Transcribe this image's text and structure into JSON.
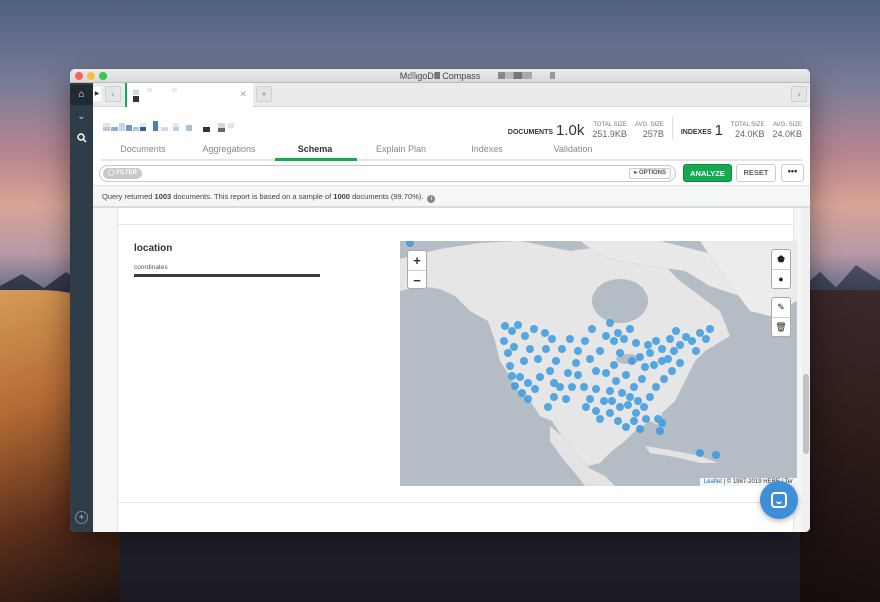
{
  "window": {
    "title": "MongoDB Compass"
  },
  "tabbar": {
    "new_tab": "+"
  },
  "header": {
    "documents_label": "DOCUMENTS",
    "documents_count": "1.0k",
    "doc_total_size_label": "TOTAL SIZE",
    "doc_total_size": "251.9KB",
    "doc_avg_size_label": "AVG. SIZE",
    "doc_avg_size": "257B",
    "indexes_label": "INDEXES",
    "indexes_count": "1",
    "idx_total_size_label": "TOTAL SIZE",
    "idx_total_size": "24.0KB",
    "idx_avg_size_label": "AVG. SIZE",
    "idx_avg_size": "24.0KB"
  },
  "tabs": [
    {
      "label": "Documents"
    },
    {
      "label": "Aggregations"
    },
    {
      "label": "Schema",
      "active": true
    },
    {
      "label": "Explain Plan"
    },
    {
      "label": "Indexes"
    },
    {
      "label": "Validation"
    }
  ],
  "querybar": {
    "filter_label": "FILTER",
    "options_label": "OPTIONS",
    "analyze_label": "ANALYZE",
    "reset_label": "RESET",
    "more_label": "•••"
  },
  "info": {
    "prefix": "Query returned",
    "returned_count": "1003",
    "middle": "documents. This report is based on a sample of",
    "sample_count": "1000",
    "suffix": "documents (99.70%)."
  },
  "schema_field": {
    "name": "location",
    "type_label": "coordinates"
  },
  "map": {
    "zoom_in": "+",
    "zoom_out": "−",
    "attribution_link": "Leaflet",
    "attribution_text": "| © 1987-2019 HERE | Ter",
    "point_color": "#3a9be0"
  },
  "colors": {
    "accent_green": "#13aa52",
    "sidebar": "#2f3d48",
    "chat_bubble": "#3c8fd8"
  }
}
